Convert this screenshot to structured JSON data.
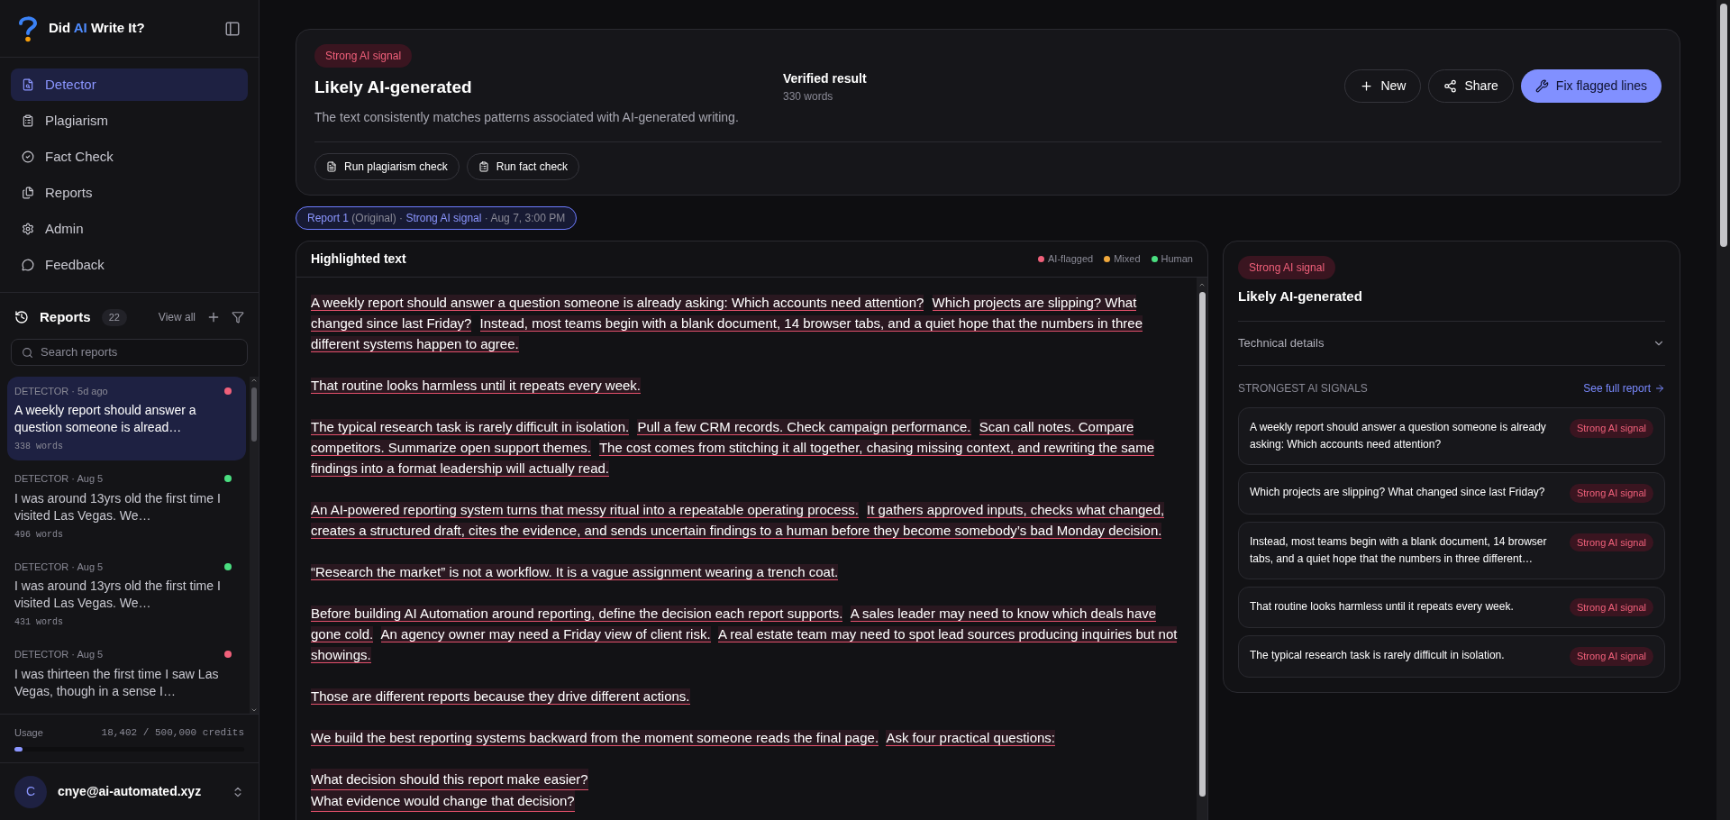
{
  "brand": {
    "before": "Did ",
    "highlight": "AI",
    "after": " Write It?"
  },
  "nav": [
    {
      "label": "Detector",
      "selected": true
    },
    {
      "label": "Plagiarism",
      "selected": false
    },
    {
      "label": "Fact Check",
      "selected": false
    },
    {
      "label": "Reports",
      "selected": false
    },
    {
      "label": "Admin",
      "selected": false
    },
    {
      "label": "Feedback",
      "selected": false
    }
  ],
  "reports": {
    "title": "Reports",
    "count": "22",
    "view_all": "View all",
    "search_placeholder": "Search reports",
    "items": [
      {
        "meta": "DETECTOR · 5d ago",
        "color": "#f0607a",
        "excerpt": "A weekly report should answer a question someone is alread…",
        "words": "338 words",
        "selected": true
      },
      {
        "meta": "DETECTOR · Aug 5",
        "color": "#4ade80",
        "excerpt": "I was around 13yrs old the first time I visited Las Vegas. We…",
        "words": "496 words",
        "selected": false
      },
      {
        "meta": "DETECTOR · Aug 5",
        "color": "#4ade80",
        "excerpt": "I was around 13yrs old the first time I visited Las Vegas. We…",
        "words": "431 words",
        "selected": false
      },
      {
        "meta": "DETECTOR · Aug 5",
        "color": "#f0607a",
        "excerpt": "I was thirteen the first time I saw Las Vegas, though in a sense I…",
        "selected": false
      }
    ]
  },
  "usage": {
    "label": "Usage",
    "reading": "18,402 / 500,000 credits",
    "level": 0.037
  },
  "user": {
    "initial": "C",
    "email": "cnye@ai-automated.xyz"
  },
  "result": {
    "badge": "Strong AI signal",
    "title": "Likely AI-generated",
    "description": "The text consistently matches patterns associated with AI-generated writing.",
    "verified": "Verified result",
    "words": "330 words",
    "actions": [
      {
        "label": "New",
        "primary": false
      },
      {
        "label": "Share",
        "primary": false
      },
      {
        "label": "Fix flagged lines",
        "primary": true
      }
    ],
    "checks": [
      {
        "label": "Run plagiarism check"
      },
      {
        "label": "Run fact check"
      }
    ]
  },
  "report_chip": {
    "report": "Report 1",
    "version": " (Original) · ",
    "signal": "Strong AI signal",
    "date": " · Aug 7, 3:00 PM"
  },
  "highlighted": {
    "title": "Highlighted text",
    "legend": [
      {
        "label": "AI-flagged",
        "color": "#f0607a"
      },
      {
        "label": "Mixed",
        "color": "#f0a83c"
      },
      {
        "label": "Human",
        "color": "#4ade80"
      }
    ],
    "paragraphs": [
      {
        "kind": "prose",
        "sentences": [
          "A weekly report should answer a question someone is already asking: Which accounts need attention?",
          "Which projects are slipping? What changed since last Friday?",
          "Instead, most teams begin with a blank document, 14 browser tabs, and a quiet hope that the numbers in three different systems happen to agree."
        ]
      },
      {
        "kind": "prose",
        "sentences": [
          "That routine looks harmless until it repeats every week."
        ]
      },
      {
        "kind": "prose",
        "sentences": [
          "The typical research task is rarely difficult in isolation.",
          "Pull a few CRM records. Check campaign performance.",
          "Scan call notes. Compare competitors. Summarize open support themes.",
          "The cost comes from stitching it all together, chasing missing context, and rewriting the same findings into a format leadership will actually read."
        ]
      },
      {
        "kind": "prose",
        "sentences": [
          "An AI-powered reporting system turns that messy ritual into a repeatable operating process.",
          "It gathers approved inputs, checks what changed, creates a structured draft, cites the evidence, and sends uncertain findings to a human before they become somebody’s bad Monday decision."
        ]
      },
      {
        "kind": "prose",
        "sentences": [
          "“Research the market” is not a workflow. It is a vague assignment wearing a trench coat."
        ]
      },
      {
        "kind": "prose",
        "sentences": [
          "Before building AI Automation around reporting, define the decision each report supports.",
          "A sales leader may need to know which deals have gone cold.",
          "An agency owner may need a Friday view of client risk.",
          "A real estate team may need to spot lead sources producing inquiries but not showings."
        ]
      },
      {
        "kind": "prose",
        "sentences": [
          "Those are different reports because they drive different actions."
        ]
      },
      {
        "kind": "prose",
        "sentences": [
          "We build the best reporting systems backward from the moment someone reads the final page.",
          "Ask four practical questions:"
        ]
      },
      {
        "kind": "lines",
        "sentences": [
          "What decision should this report make easier?",
          "What evidence would change that decision?"
        ]
      }
    ]
  },
  "summary": {
    "badge": "Strong AI signal",
    "title": "Likely AI-generated",
    "details": "Technical details",
    "details_expanded": false,
    "signals_title": "STRONGEST AI SIGNALS",
    "see_full": "See full report",
    "signals": [
      {
        "text": "A weekly report should answer a question someone is already asking: Which accounts need attention?",
        "badge": "Strong AI signal"
      },
      {
        "text": "Which projects are slipping? What changed since last Friday?",
        "badge": "Strong AI signal"
      },
      {
        "text": "Instead, most teams begin with a blank document, 14 browser tabs, and a quiet hope that the numbers in three different…",
        "badge": "Strong AI signal"
      },
      {
        "text": "That routine looks harmless until it repeats every week.",
        "badge": "Strong AI signal"
      },
      {
        "text": "The typical research task is rarely difficult in isolation.",
        "badge": "Strong AI signal"
      }
    ]
  }
}
